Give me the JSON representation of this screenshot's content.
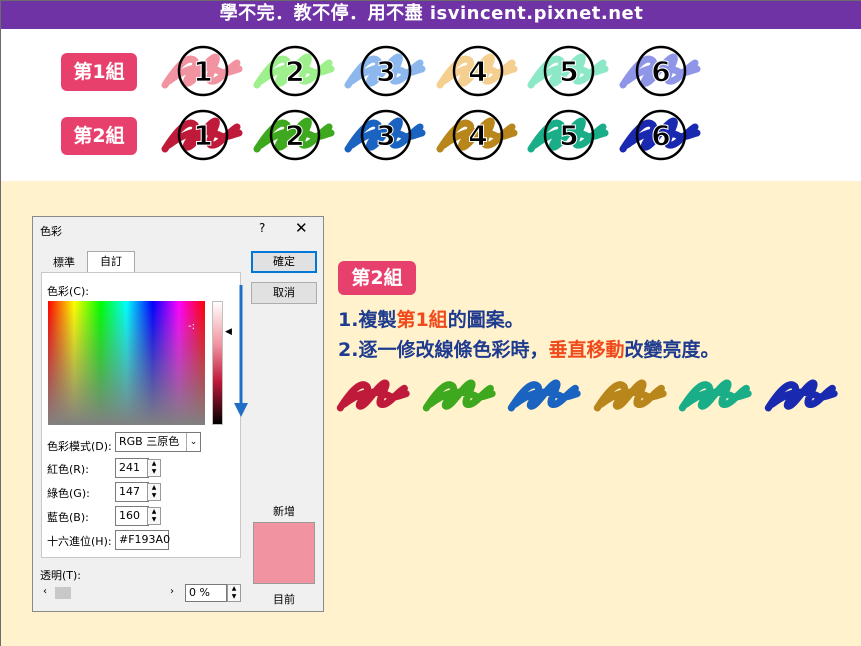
{
  "banner": {
    "text": "學不完．教不停．用不盡 isvincent.pixnet.net"
  },
  "groups": {
    "group1_label": "第1組",
    "group2_label": "第2組",
    "numbers": [
      "1",
      "2",
      "3",
      "4",
      "5",
      "6"
    ],
    "group1_colors": [
      "#f193a0",
      "#9ef08c",
      "#8cb8ee",
      "#f5cf8f",
      "#8de8c8",
      "#8f96e8"
    ],
    "group2_colors": [
      "#c01a3a",
      "#3ea81e",
      "#1a63c0",
      "#b8861a",
      "#1aae88",
      "#1a2ab0"
    ]
  },
  "dialog": {
    "title": "色彩",
    "help": "?",
    "close": "✕",
    "tab_standard": "標準",
    "tab_custom": "自訂",
    "colors_label": "色彩(C):",
    "ok": "確定",
    "cancel": "取消",
    "color_model_label": "色彩模式(D):",
    "color_model_value": "RGB 三原色",
    "red_label": "紅色(R):",
    "red_value": "241",
    "green_label": "綠色(G):",
    "green_value": "147",
    "blue_label": "藍色(B):",
    "blue_value": "160",
    "hex_label": "十六進位(H):",
    "hex_value": "#F193A0",
    "transparency_label": "透明(T):",
    "transparency_value": "0 %",
    "new_label": "新增",
    "current_label": "目前",
    "current_color": "#f193a0"
  },
  "instructions": {
    "badge": "第2組",
    "line1_prefix": "1.複製",
    "line1_highlight": "第1組",
    "line1_suffix": "的圖案。",
    "line2_prefix": "2.逐一修改線條色彩時，",
    "line2_highlight": "垂直移動",
    "line2_suffix": "改變亮度。",
    "scribble_colors": [
      "#c01a3a",
      "#3ea81e",
      "#1a63c0",
      "#b8861a",
      "#1aae88",
      "#1a2ab0"
    ]
  }
}
